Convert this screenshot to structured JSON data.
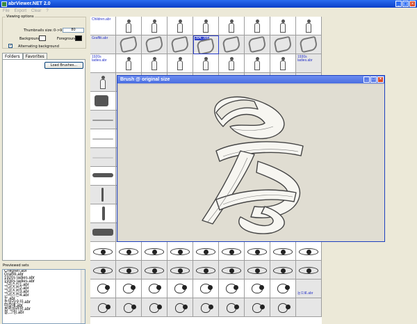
{
  "window": {
    "title": "abrViewer.NET 2.0",
    "minimize": "_",
    "maximize": "□",
    "close": "×"
  },
  "menu": [
    "File",
    "Export",
    "Clear",
    "?"
  ],
  "viewing_options": {
    "title": "Viewing options",
    "thumb_label": "Thumbnails size:",
    "thumb_range": "0->9",
    "thumb_value": "80",
    "background_label": "Background:",
    "foreground_label": "Foreground:",
    "background_color": "#ffffff",
    "foreground_color": "#000000",
    "alternating_label": "Alternating background",
    "alternating_checked": "✓"
  },
  "tabs": [
    "Folders",
    "Favorites"
  ],
  "load_button": "Load Brushes...",
  "previewed": {
    "title": "Previewed sets",
    "items": [
      "Children.abr",
      "Graffiti.abr",
      "1920s ladies.abr",
      "1930s ladies.abr",
      "그리스신1.abr",
      "그리스신2.abr",
      "그리스신3.abr",
      "그리스신4.abr",
      "눈.abr",
      "눈보라숫자.abr",
      "따갈매.abr",
      "봄의화려함.abr",
      "블,그림.abr"
    ]
  },
  "grid_labels": {
    "children": "Children.abr",
    "graffiti": "Graffiti.abr",
    "selected": "304, 395",
    "ladies1920": "1920s ladies.abr",
    "ladies1930": "1930s ladies.abr",
    "lastset": "눈으로.abr"
  },
  "popup": {
    "title": "Brush @ original size",
    "minimize": "_",
    "maximize": "□",
    "close": "×"
  }
}
